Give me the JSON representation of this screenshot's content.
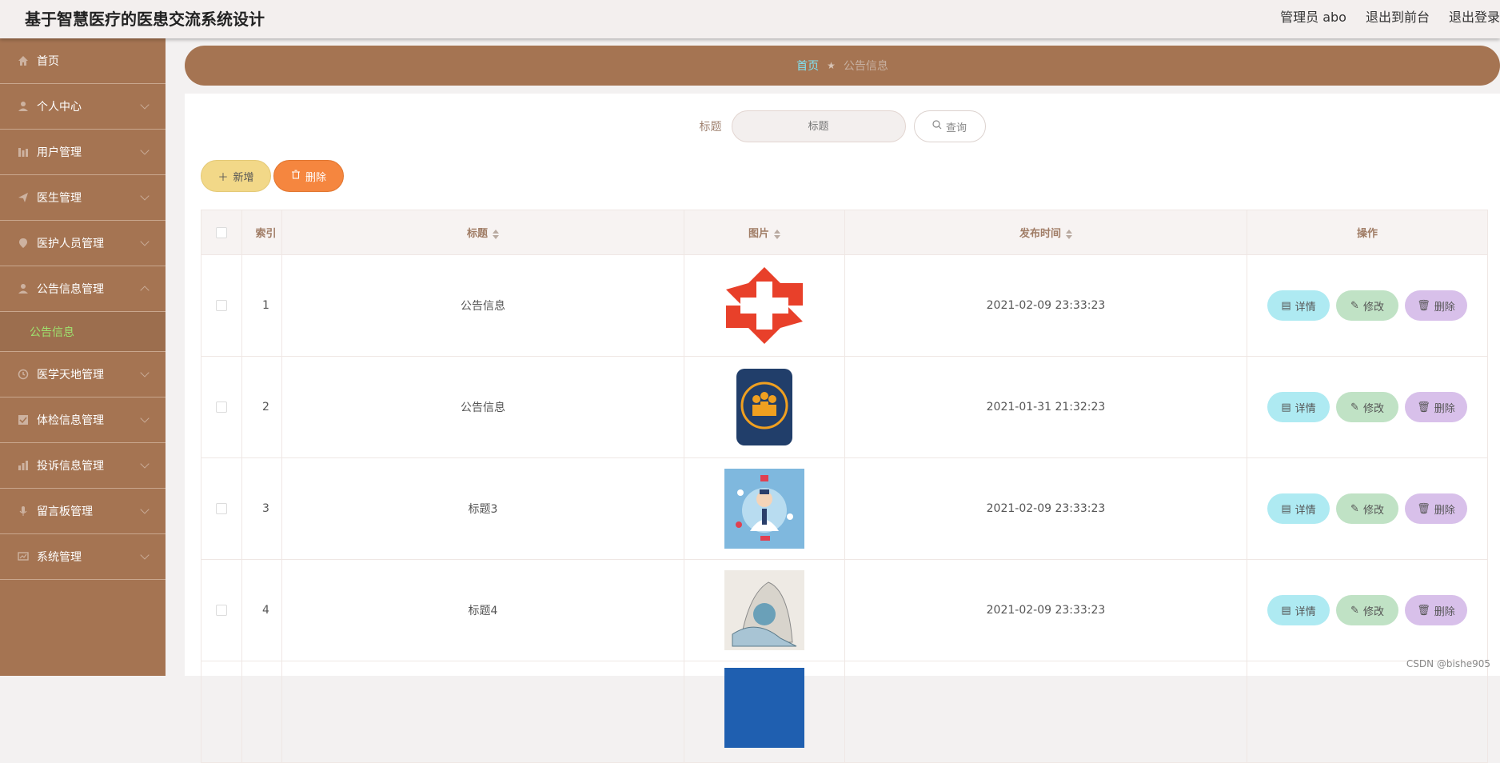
{
  "app": {
    "title": "基于智慧医疗的医患交流系统设计"
  },
  "header": {
    "user_label": "管理员 abo",
    "front_link": "退出到前台",
    "logout_link": "退出登录"
  },
  "sidebar": {
    "items": [
      {
        "label": "首页",
        "icon": "home-icon"
      },
      {
        "label": "个人中心",
        "icon": "user-icon"
      },
      {
        "label": "用户管理",
        "icon": "chart-icon"
      },
      {
        "label": "医生管理",
        "icon": "send-icon"
      },
      {
        "label": "医护人员管理",
        "icon": "location-icon"
      },
      {
        "label": "公告信息管理",
        "icon": "user-icon"
      },
      {
        "label": "医学天地管理",
        "icon": "clock-icon"
      },
      {
        "label": "体检信息管理",
        "icon": "check-icon"
      },
      {
        "label": "投诉信息管理",
        "icon": "bar-chart-icon"
      },
      {
        "label": "留言板管理",
        "icon": "mic-icon"
      },
      {
        "label": "系统管理",
        "icon": "system-icon"
      }
    ],
    "submenu_label": "公告信息"
  },
  "breadcrumb": {
    "home": "首页",
    "current": "公告信息"
  },
  "search": {
    "label": "标题",
    "placeholder": "标题",
    "button": "查询"
  },
  "actions": {
    "add": "新增",
    "delete": "删除"
  },
  "table": {
    "headers": {
      "index": "索引",
      "title": "标题",
      "image": "图片",
      "time": "发布时间",
      "ops": "操作"
    },
    "rows": [
      {
        "index": "1",
        "title": "公告信息",
        "time": "2021-02-09 23:33:23",
        "image": "red-cross-icon"
      },
      {
        "index": "2",
        "title": "公告信息",
        "time": "2021-01-31 21:32:23",
        "image": "medical-team-badge-icon"
      },
      {
        "index": "3",
        "title": "标题3",
        "time": "2021-02-09 23:33:23",
        "image": "doctor-illustration"
      },
      {
        "index": "4",
        "title": "标题4",
        "time": "2021-02-09 23:33:23",
        "image": "sketch-illustration"
      }
    ],
    "op_labels": {
      "detail": "详情",
      "edit": "修改",
      "delete": "删除"
    }
  },
  "watermark": "CSDN @bishe905",
  "colors": {
    "brand": "#a57452",
    "breadcrumb_home": "#7fe3f4",
    "submenu_active": "#9ee36f",
    "add_button": "#f2d888",
    "delete_button": "#f5863f",
    "detail_button": "#aeeaf2",
    "edit_button": "#c0e2c5",
    "op_delete_button": "#d8c0ea"
  }
}
